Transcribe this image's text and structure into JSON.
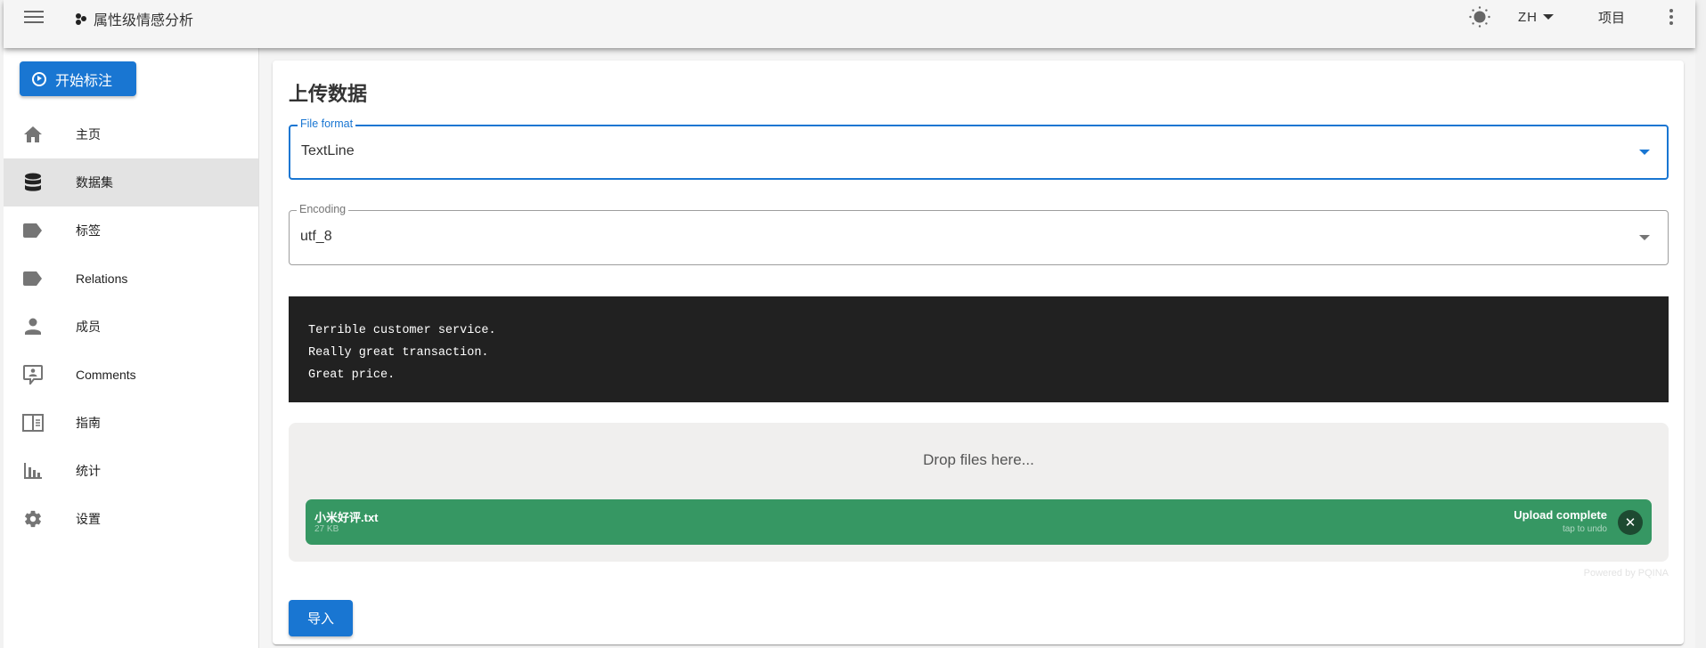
{
  "header": {
    "menu_icon": "hamburger-menu-icon",
    "brand_icon": "hexagon-dots-logo-icon",
    "title": "属性级情感分析",
    "theme_icon": "sun-brightness-icon",
    "language": "ZH",
    "projects_label": "项目",
    "more_icon": "more-vertical-icon"
  },
  "sidebar": {
    "start_button": {
      "label": "开始标注",
      "icon": "play-circle-icon"
    },
    "items": [
      {
        "label": "主页",
        "icon": "home-icon",
        "active": false
      },
      {
        "label": "数据集",
        "icon": "database-icon",
        "active": true
      },
      {
        "label": "标签",
        "icon": "label-icon",
        "active": false
      },
      {
        "label": "Relations",
        "icon": "label-icon",
        "active": false
      },
      {
        "label": "成员",
        "icon": "person-icon",
        "active": false
      },
      {
        "label": "Comments",
        "icon": "comment-account-icon",
        "active": false
      },
      {
        "label": "指南",
        "icon": "book-open-icon",
        "active": false
      },
      {
        "label": "统计",
        "icon": "chart-bar-icon",
        "active": false
      },
      {
        "label": "设置",
        "icon": "gear-icon",
        "active": false
      }
    ]
  },
  "main": {
    "title": "上传数据",
    "file_format": {
      "label": "File format",
      "value": "TextLine"
    },
    "encoding": {
      "label": "Encoding",
      "value": "utf_8"
    },
    "example_lines": [
      "Terrible customer service.",
      "Really great transaction.",
      "Great price."
    ],
    "dropzone": {
      "placeholder": "Drop files here...",
      "file": {
        "name": "小米好评.txt",
        "size": "27 KB",
        "status": "Upload complete",
        "sub_status": "tap to undo"
      },
      "credit": "Powered by PQINA"
    },
    "import_button": "导入"
  },
  "colors": {
    "primary": "#1976d2",
    "upload_success": "#369763",
    "preview_bg": "#212121"
  }
}
